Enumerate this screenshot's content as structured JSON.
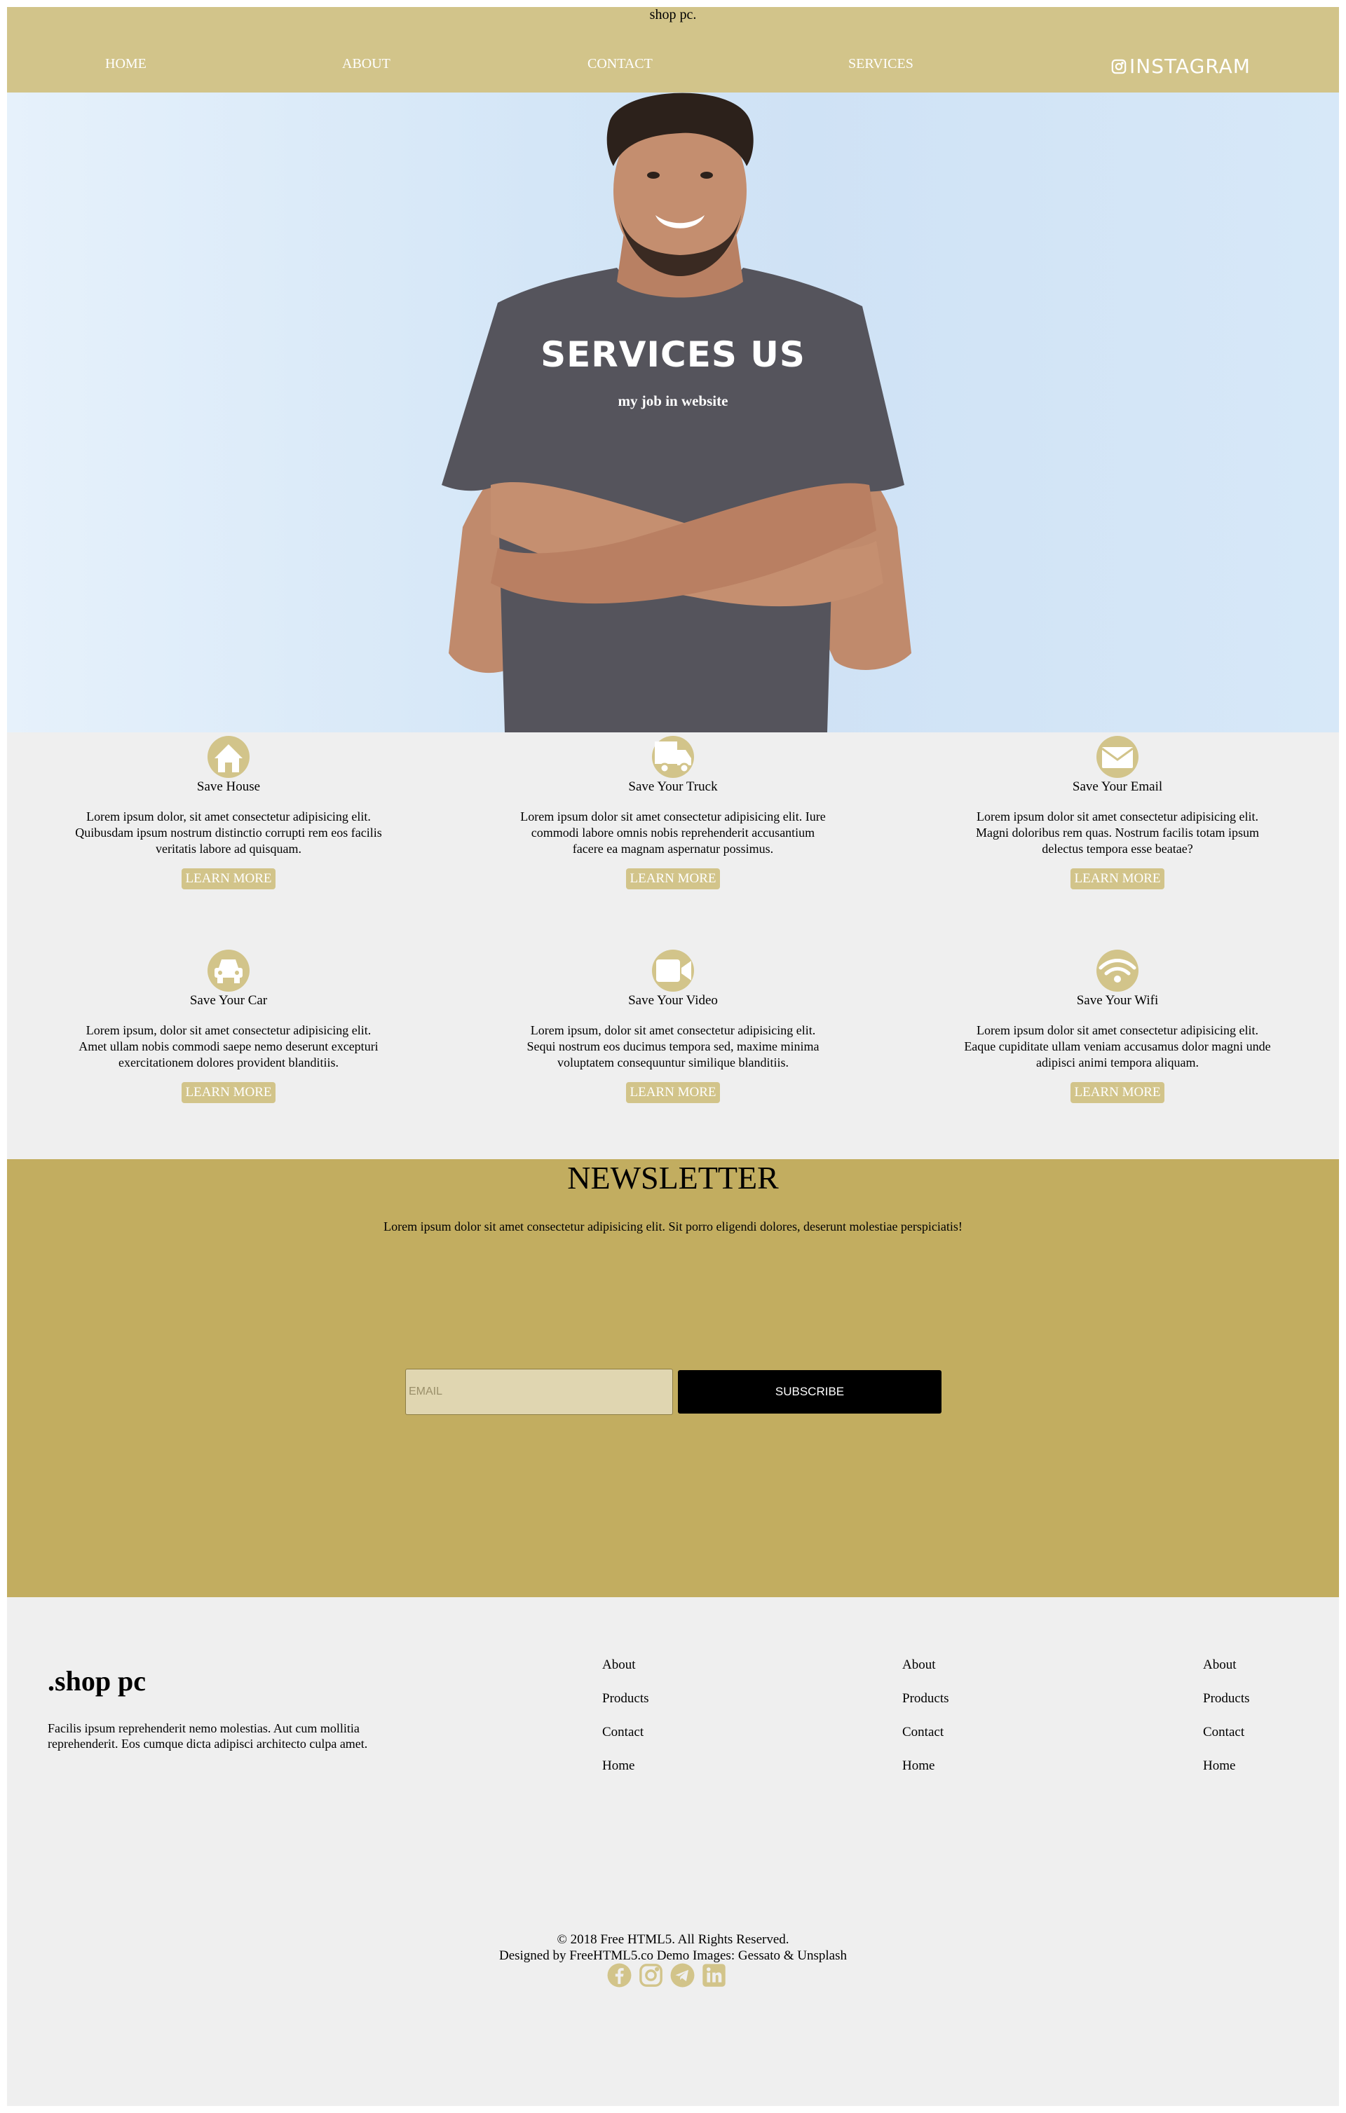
{
  "header": {
    "brand": "shop pc.",
    "nav": [
      "HOME",
      "ABOUT",
      "CONTACT",
      "SERVICES"
    ],
    "instagram_label": "INSTAGRAM"
  },
  "hero": {
    "title": "SERVICES US",
    "subtitle": "my job in website"
  },
  "services": [
    {
      "icon": "house-icon",
      "title": "Save House",
      "desc": "Lorem ipsum dolor, sit amet consectetur adipisicing elit. Quibusdam ipsum nostrum distinctio corrupti rem eos facilis veritatis labore ad quisquam.",
      "button": "LEARN MORE"
    },
    {
      "icon": "truck-icon",
      "title": "Save Your Truck",
      "desc": "Lorem ipsum dolor sit amet consectetur adipisicing elit. Iure commodi labore omnis nobis reprehenderit accusantium facere ea magnam aspernatur possimus.",
      "button": "LEARN MORE"
    },
    {
      "icon": "email-icon",
      "title": "Save Your Email",
      "desc": "Lorem ipsum dolor sit amet consectetur adipisicing elit. Magni doloribus rem quas. Nostrum facilis totam ipsum delectus tempora esse beatae?",
      "button": "LEARN MORE"
    },
    {
      "icon": "car-icon",
      "title": "Save Your Car",
      "desc": "Lorem ipsum, dolor sit amet consectetur adipisicing elit. Amet ullam nobis commodi saepe nemo deserunt excepturi exercitationem dolores provident blanditiis.",
      "button": "LEARN MORE"
    },
    {
      "icon": "video-icon",
      "title": "Save Your Video",
      "desc": "Lorem ipsum, dolor sit amet consectetur adipisicing elit. Sequi nostrum eos ducimus tempora sed, maxime minima voluptatem consequuntur similique blanditiis.",
      "button": "LEARN MORE"
    },
    {
      "icon": "wifi-icon",
      "title": "Save Your Wifi",
      "desc": "Lorem ipsum dolor sit amet consectetur adipisicing elit. Eaque cupiditate ullam veniam accusamus dolor magni unde adipisci animi tempora aliquam.",
      "button": "LEARN MORE"
    }
  ],
  "newsletter": {
    "title": "NEWSLETTER",
    "text": "Lorem ipsum dolor sit amet consectetur adipisicing elit. Sit porro eligendi dolores, deserunt molestiae perspiciatis!",
    "email_placeholder": "EMAIL",
    "subscribe_label": "SUBSCRIBE"
  },
  "footer": {
    "logo": ".shop pc",
    "desc": "Facilis ipsum reprehenderit nemo molestias. Aut cum mollitia reprehenderit. Eos cumque dicta adipisci architecto culpa amet.",
    "columns": [
      [
        "About",
        "Products",
        "Contact",
        "Home"
      ],
      [
        "About",
        "Products",
        "Contact",
        "Home"
      ],
      [
        "About",
        "Products",
        "Contact",
        "Home"
      ]
    ],
    "copyright": "© 2018 Free HTML5. All Rights Reserved.",
    "credits": "Designed by FreeHTML5.co Demo Images: Gessato & Unsplash",
    "social_icons": [
      "facebook-icon",
      "instagram-icon",
      "telegram-icon",
      "linkedin-icon"
    ]
  },
  "colors": {
    "accent": "#d2c48a",
    "newsletter_bg": "#c2ad60",
    "page_bg": "#efefef"
  }
}
